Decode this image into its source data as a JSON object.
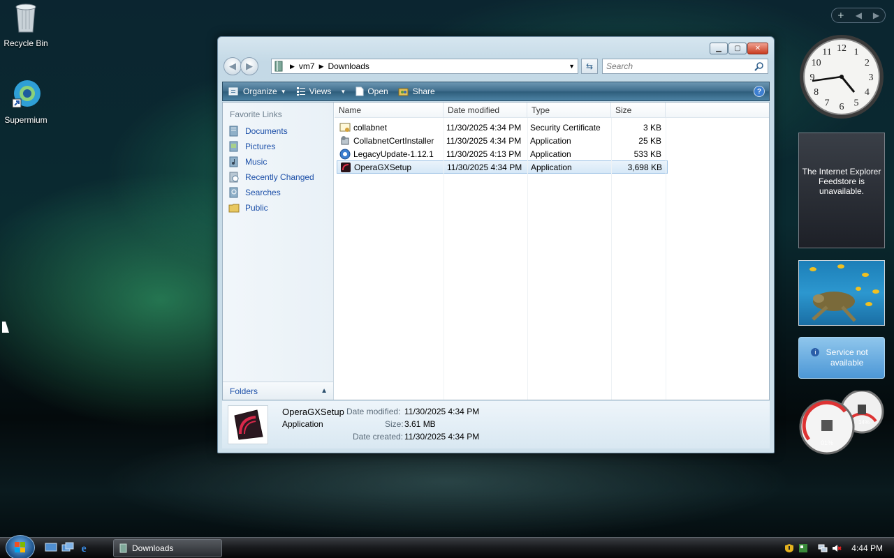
{
  "desktop": {
    "icons": [
      {
        "label": "Recycle Bin"
      },
      {
        "label": "Supermium"
      }
    ]
  },
  "window": {
    "address": {
      "segments": [
        "vm7",
        "Downloads"
      ]
    },
    "search": {
      "placeholder": "Search"
    },
    "toolbar": {
      "organize": "Organize",
      "views": "Views",
      "open": "Open",
      "share": "Share",
      "help": "?"
    },
    "sidebar": {
      "heading": "Favorite Links",
      "links": [
        "Documents",
        "Pictures",
        "Music",
        "Recently Changed",
        "Searches",
        "Public"
      ],
      "folders": "Folders"
    },
    "columns": {
      "name": "Name",
      "date": "Date modified",
      "type": "Type",
      "size": "Size"
    },
    "files": [
      {
        "name": "collabnet",
        "date": "11/30/2025 4:34 PM",
        "type": "Security Certificate",
        "size": "3 KB"
      },
      {
        "name": "CollabnetCertInstaller",
        "date": "11/30/2025 4:34 PM",
        "type": "Application",
        "size": "25 KB"
      },
      {
        "name": "LegacyUpdate-1.12.1",
        "date": "11/30/2025 4:13 PM",
        "type": "Application",
        "size": "533 KB"
      },
      {
        "name": "OperaGXSetup",
        "date": "11/30/2025 4:34 PM",
        "type": "Application",
        "size": "3,698 KB"
      }
    ],
    "details": {
      "name": "OperaGXSetup",
      "type": "Application",
      "modified_label": "Date modified:",
      "modified": "11/30/2025 4:34 PM",
      "size_label": "Size:",
      "size": "3.61 MB",
      "created_label": "Date created:",
      "created": "11/30/2025 4:34 PM"
    }
  },
  "gadgets": {
    "feed_message": "The Internet Explorer Feedstore is unavailable.",
    "weather_message": "Service not available",
    "cpu_percent": "01%",
    "mem_percent": "14%",
    "clock_numbers": [
      "12",
      "1",
      "2",
      "3",
      "4",
      "5",
      "6",
      "7",
      "8",
      "9",
      "10",
      "11"
    ]
  },
  "taskbar": {
    "task": "Downloads",
    "time": "4:44 PM"
  },
  "colors": {
    "link": "#1c4fa8",
    "toolbar": "#3f6d8c",
    "selection": "#d6e8f7"
  }
}
